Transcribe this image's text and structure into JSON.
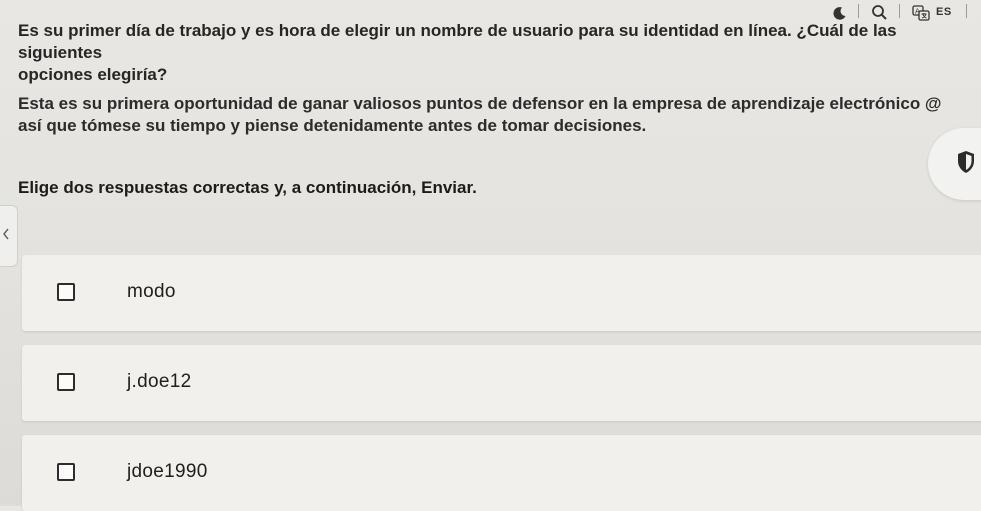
{
  "toolbar": {
    "icons": [
      "moon-icon",
      "search-icon",
      "translate-icon"
    ],
    "language": "ES"
  },
  "question": {
    "line1": "Es su primer día de trabajo y es hora de elegir un nombre de usuario para su identidad en línea. ¿Cuál de las siguientes",
    "line2": "opciones elegiría?"
  },
  "context": {
    "line1": "Esta es su primera oportunidad de ganar valiosos puntos de defensor en la empresa de aprendizaje electrónico @",
    "line2": "así que tómese su tiempo y piense detenidamente antes de tomar decisiones."
  },
  "instruction": "Elige dos respuestas correctas y, a continuación, Enviar.",
  "options": [
    {
      "label": "modo",
      "checked": false
    },
    {
      "label": "j.doe12",
      "checked": false
    },
    {
      "label": "jdoe1990",
      "checked": false
    }
  ],
  "colors": {
    "background": "#e4e3df",
    "card": "#f1f0ed",
    "text": "#1e1e1e"
  }
}
